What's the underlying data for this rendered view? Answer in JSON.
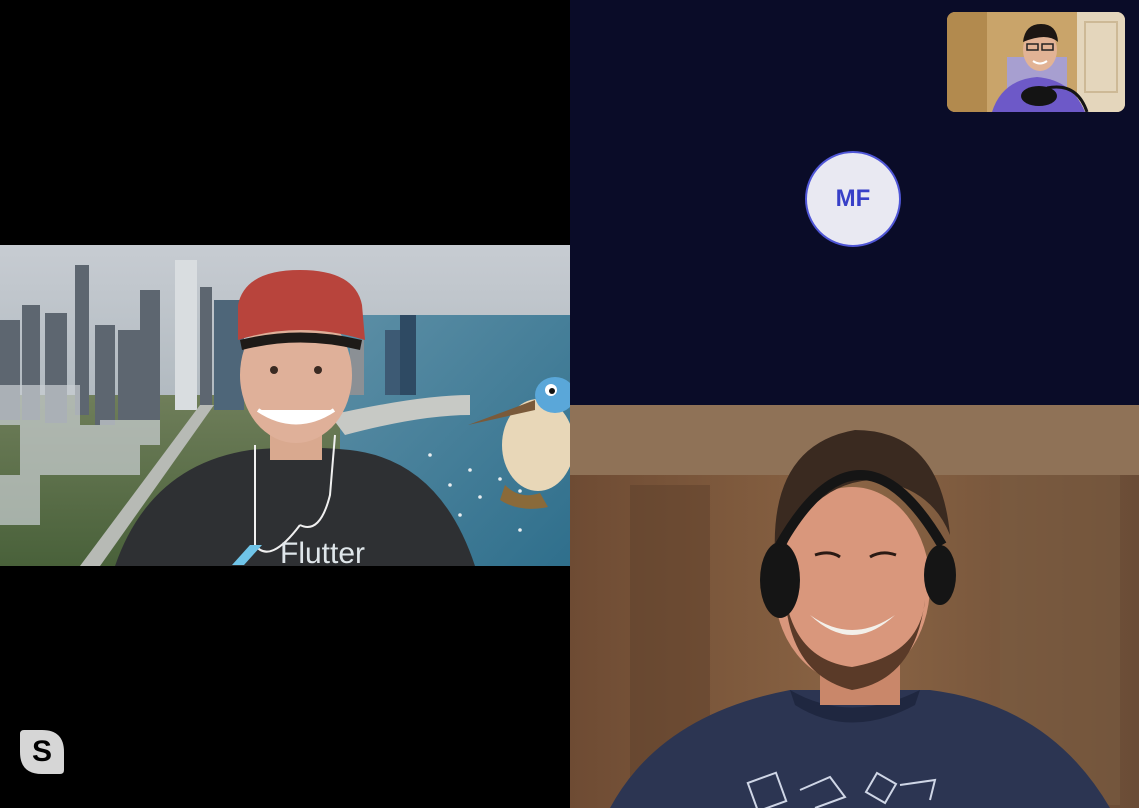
{
  "call": {
    "participant_mf": {
      "initials": "MF"
    },
    "participant_left": {
      "shirt_text": "Flutter"
    }
  },
  "icons": {
    "app_logo": "skype-logo-icon",
    "app_logo_letter": "S"
  },
  "colors": {
    "background": "#000000",
    "avatar_panel": "#0a0c28",
    "avatar_fill": "#e9e9f2",
    "avatar_text": "#3840c8",
    "avatar_border": "#4f56d6"
  }
}
